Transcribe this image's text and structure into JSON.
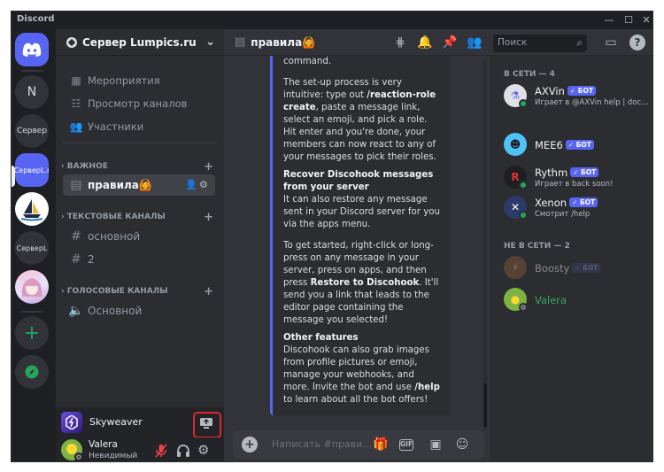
{
  "window": {
    "app_title": "Discord",
    "minimize": "—",
    "maximize": "☐",
    "close": "✕"
  },
  "rail": {
    "home_logo": "discord-logo",
    "servers": [
      {
        "label": "N"
      },
      {
        "label": "Сервер"
      },
      {
        "label": "СерверL.r"
      },
      {
        "label": ""
      },
      {
        "label": "СерверL"
      },
      {
        "label": ""
      }
    ],
    "add": "+",
    "explore": "◎"
  },
  "sidebar": {
    "server_name": "Сервер Lumpics.ru",
    "nav": [
      {
        "label": "Мероприятия",
        "icon": "calendar-icon"
      },
      {
        "label": "Просмотр каналов",
        "icon": "browse-icon"
      },
      {
        "label": "Участники",
        "icon": "members-icon"
      }
    ],
    "categories": [
      {
        "label": "ВАЖНОЕ",
        "channels": [
          {
            "name": "правила🙆"
          }
        ]
      },
      {
        "label": "ТЕКСТОВЫЕ КАНАЛЫ",
        "channels": [
          {
            "name": "основной"
          },
          {
            "name": "2"
          }
        ]
      },
      {
        "label": "ГОЛОСОВЫЕ КАНАЛЫ",
        "channels": [
          {
            "name": "Основной"
          }
        ]
      }
    ]
  },
  "activity": {
    "name": "Skyweaver"
  },
  "user": {
    "name": "Valera",
    "status": "Невидимый"
  },
  "chat": {
    "channel": "правила🙆",
    "embed": {
      "lead": "command.",
      "p1": [
        "The set-up process is very intuitive: type out ",
        "/reaction-role create",
        ", paste a message link, select an emoji, and pick a role. Hit enter and you're done, your members can now react to any of your messages to pick their roles."
      ],
      "h2": "Recover Discohook messages from your server",
      "p2": "It can also restore any message sent in your Discord server for you via the apps menu.",
      "p3": [
        "To get started, right-click or long-press on any message in your server, press on apps, and then press ",
        "Restore to Discohook",
        ". It'll send you a link that leads to the editor page containing the message you selected!"
      ],
      "h3": "Other features",
      "p4": [
        "Discohook can also grab images from profile pictures or emoji, manage your webhooks, and more. Invite the bot and use ",
        "/help",
        " to learn about all the bot offers!"
      ]
    },
    "composer_placeholder": "Написать #прави..."
  },
  "toolbar": {
    "search_placeholder": "Поиск"
  },
  "members": {
    "online_header": "В СЕТИ — 4",
    "offline_header": "НЕ В СЕТИ — 2",
    "bot_badge": "✓ БОТ",
    "online": [
      {
        "name": "AXVin",
        "bot": true,
        "activity": "Играет в @AXVin help | docs....",
        "avatar_color": "#dfe1e5"
      },
      {
        "name": "MEE6",
        "bot": true,
        "activity": "",
        "avatar_color": "#4fc3f7"
      },
      {
        "name": "Rythm",
        "bot": true,
        "activity": "Играет в back soon!",
        "avatar_color": "#1e1f22"
      },
      {
        "name": "Xenon",
        "bot": true,
        "activity": "Смотрит /help",
        "avatar_color": "#2b3a67"
      }
    ],
    "offline": [
      {
        "name": "Boosty",
        "bot": true,
        "avatar_color": "#8a5a3c"
      },
      {
        "name": "Valera",
        "bot": false,
        "avatar_color": "#7cb342",
        "name_color": "#3ba55d"
      }
    ]
  }
}
